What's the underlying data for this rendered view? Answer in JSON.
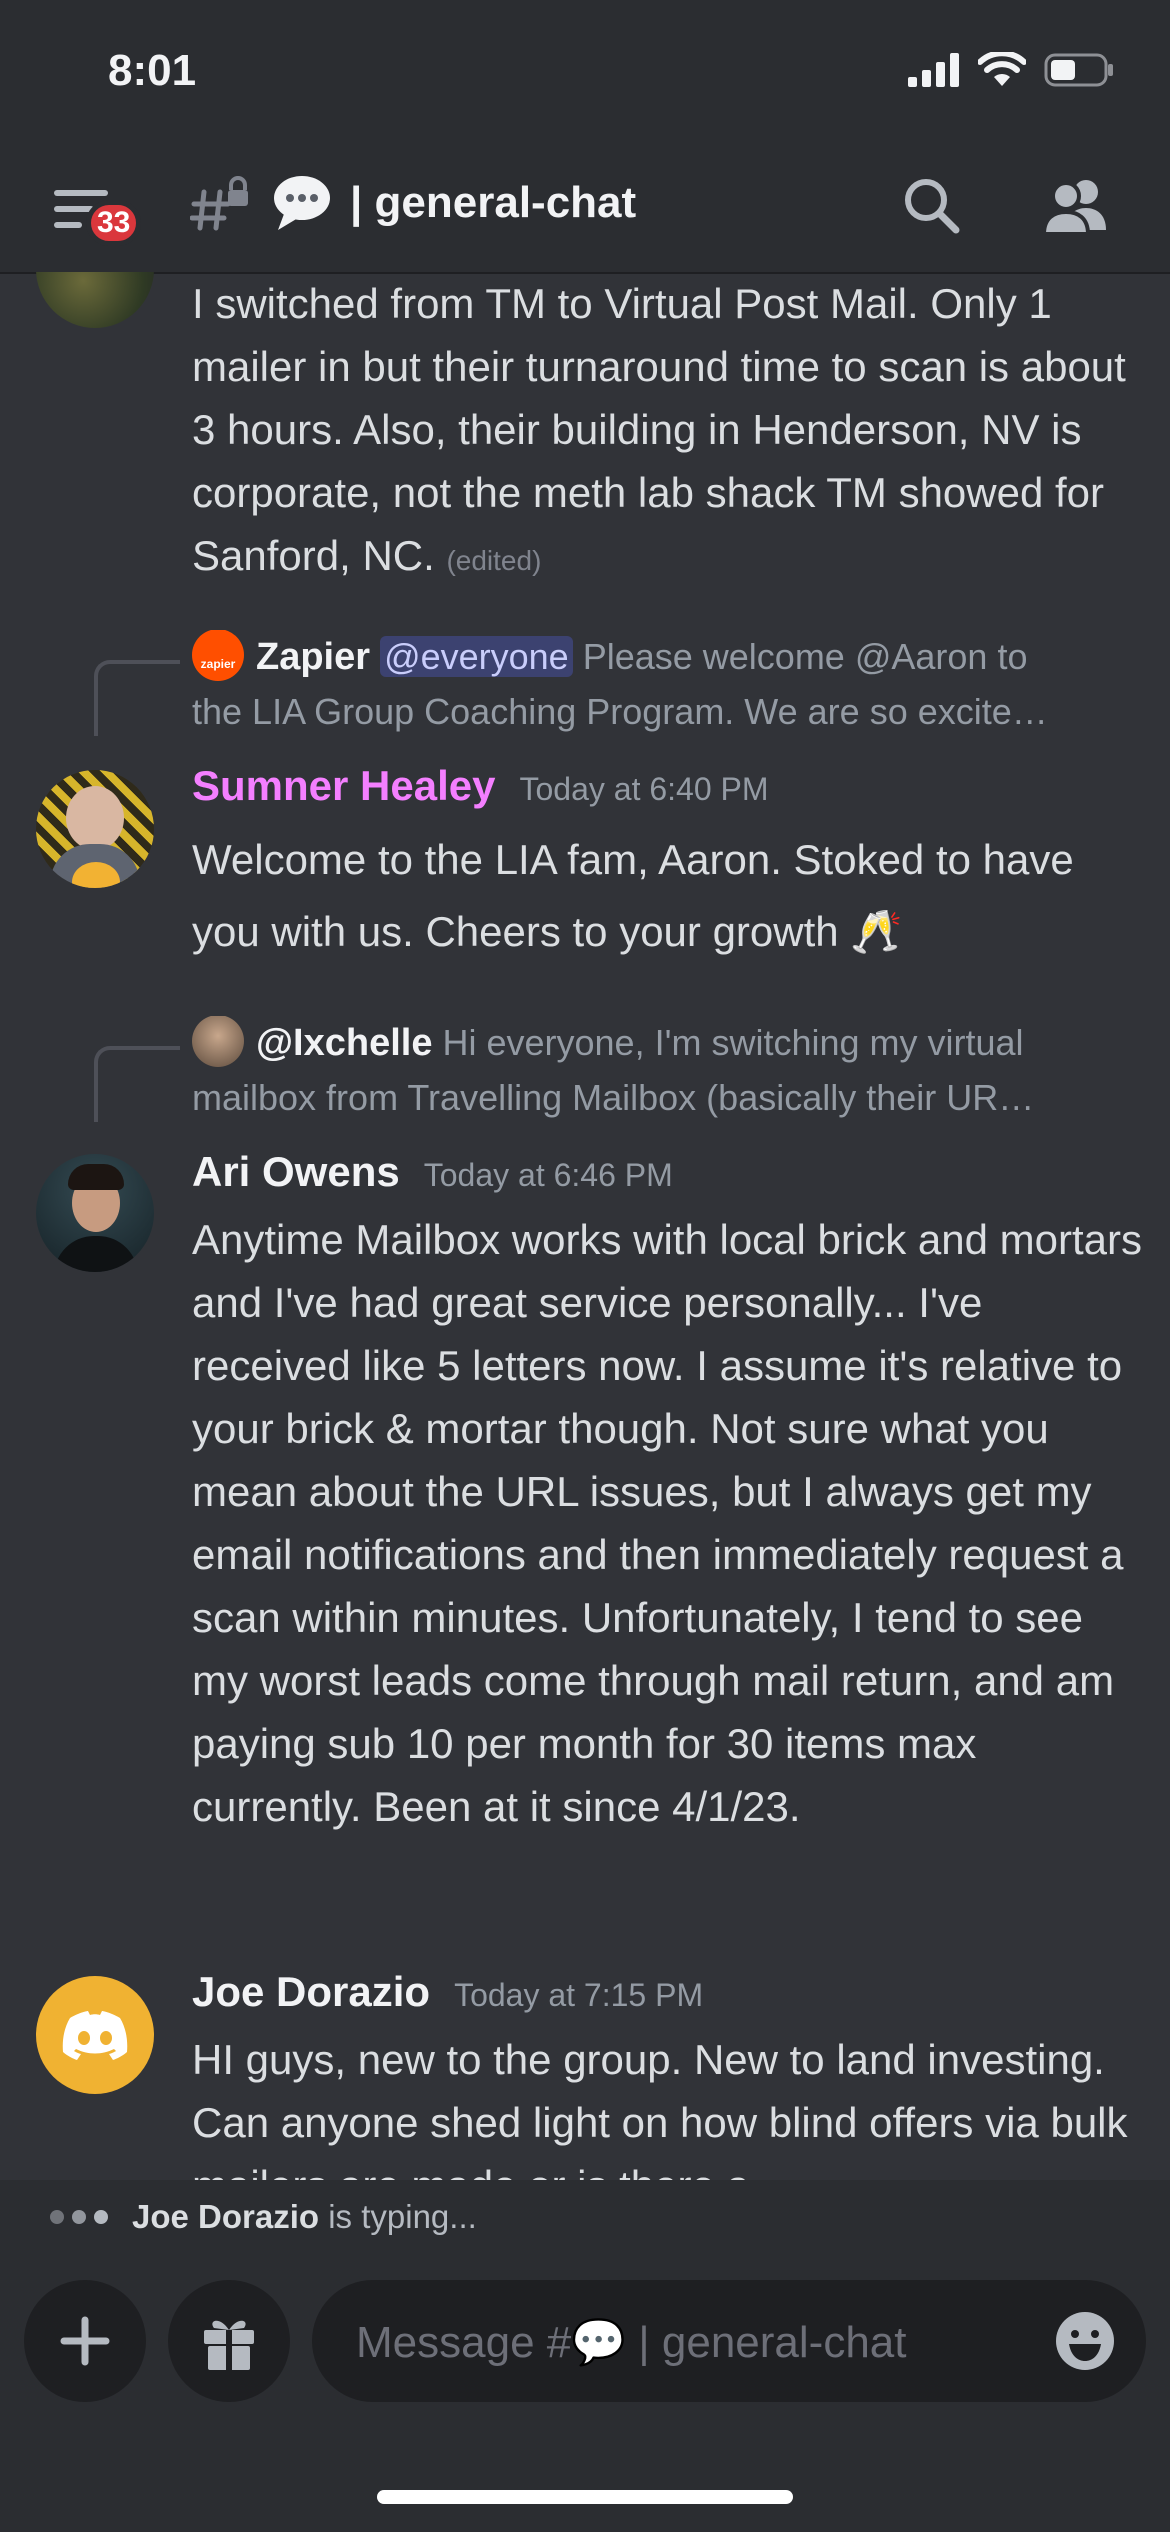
{
  "status": {
    "time": "8:01"
  },
  "header": {
    "notification_count": "33",
    "channel_separator": "| ",
    "channel_name": "general-chat"
  },
  "messages": [
    {
      "text": "I switched from TM to Virtual Post Mail. Only 1 mailer in but their turnaround time to scan is about 3 hours. Also, their building in Henderson, NV is corporate, not the meth lab shack TM showed for Sanford, NC.",
      "edited": "(edited)"
    },
    {
      "reply": {
        "author": "Zapier",
        "avatar_label": "zapier",
        "mention": "@everyone",
        "line1": " Please welcome @Aaron to",
        "line2": "the LIA Group Coaching Program. We are so excite…"
      },
      "author": "Sumner Healey",
      "author_color": "#f47fff",
      "time": "Today at 6:40 PM",
      "text": "Welcome to the LIA fam, Aaron. Stoked to have you with us. Cheers to your growth 🥂"
    },
    {
      "reply": {
        "author": "@Ixchelle",
        "line1": " Hi everyone, I'm switching my virtual",
        "line2": "mailbox from Travelling Mailbox (basically their UR…"
      },
      "author": "Ari Owens",
      "time": "Today at 6:46 PM",
      "text": "Anytime Mailbox works with local brick and mortars and I've had great service personally... I've received like 5 letters now. I assume it's relative to your brick & mortar though. Not sure what you mean about the URL issues, but I always get my email notifications and then immediately request a scan within minutes. Unfortunately, I tend to see my worst leads come through mail return, and am paying sub 10 per month for 30 items max currently. Been at it since 4/1/23."
    },
    {
      "author": "Joe Dorazio",
      "time": "Today at 7:15 PM",
      "text": "HI guys, new to the group. New to land investing.  Can anyone shed light on how blind offers via bulk mailers are made or is there a"
    }
  ],
  "typing": {
    "user": "Joe Dorazio",
    "suffix": " is typing..."
  },
  "composer": {
    "placeholder": "Message #💬 | general-chat"
  },
  "colors": {
    "background": "#313338",
    "header": "#2b2d31",
    "badge": "#da373c",
    "discord_orange": "#f0b232"
  }
}
